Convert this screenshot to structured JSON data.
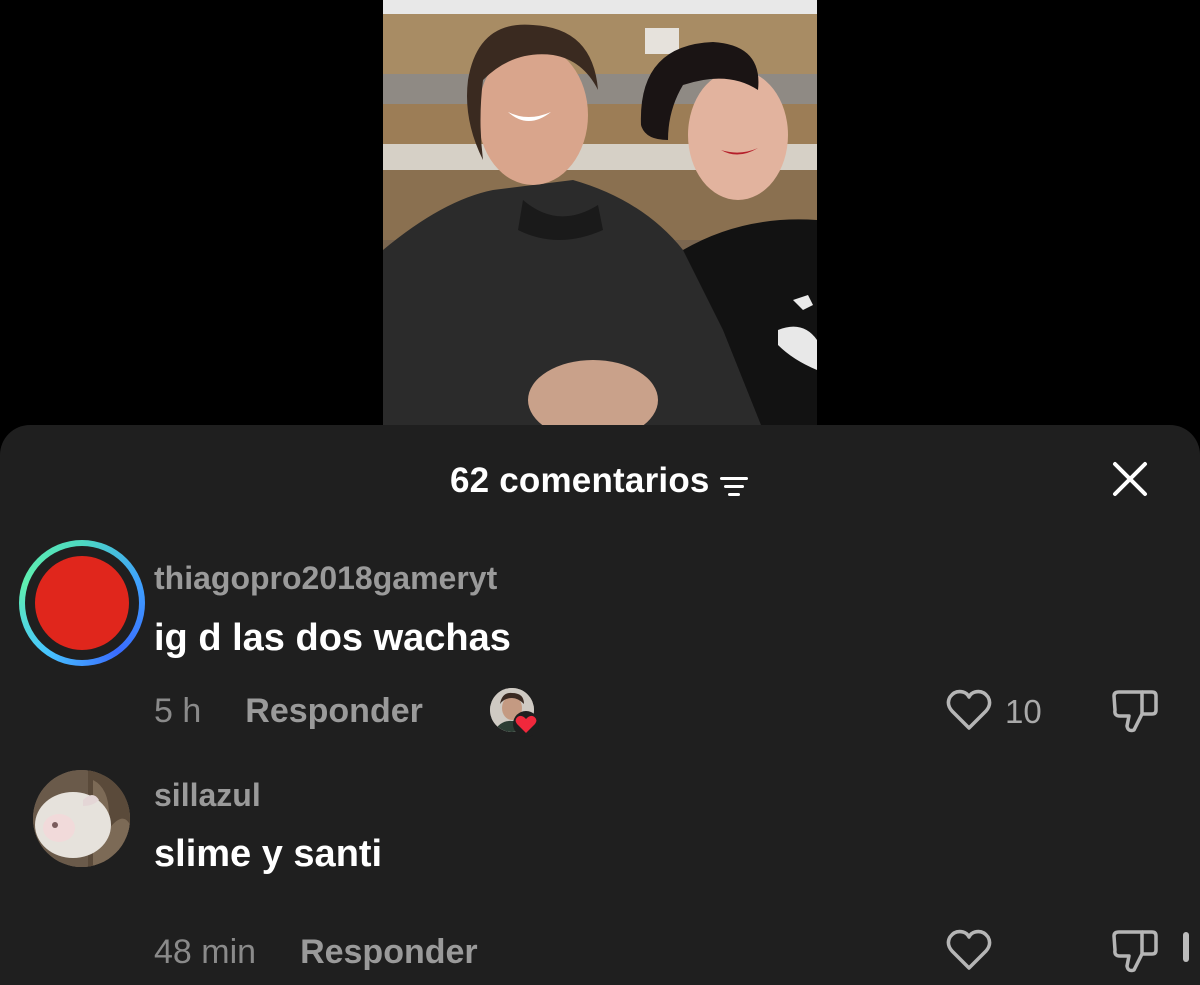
{
  "header": {
    "title": "62 comentarios"
  },
  "comments": [
    {
      "username": "thiagopro2018gameryt",
      "text": "ig d las dos wachas",
      "time": "5 h",
      "reply_label": "Responder",
      "likes": "10",
      "liked_by_creator": true,
      "avatar_color": "#e0261c"
    },
    {
      "username": "sillazul",
      "text": "slime y santi",
      "time": "48 min",
      "reply_label": "Responder",
      "likes": ""
    }
  ],
  "icons": {
    "filter": "filter-icon",
    "close": "close-icon",
    "like": "heart-outline-icon",
    "dislike": "thumbs-down-icon"
  }
}
